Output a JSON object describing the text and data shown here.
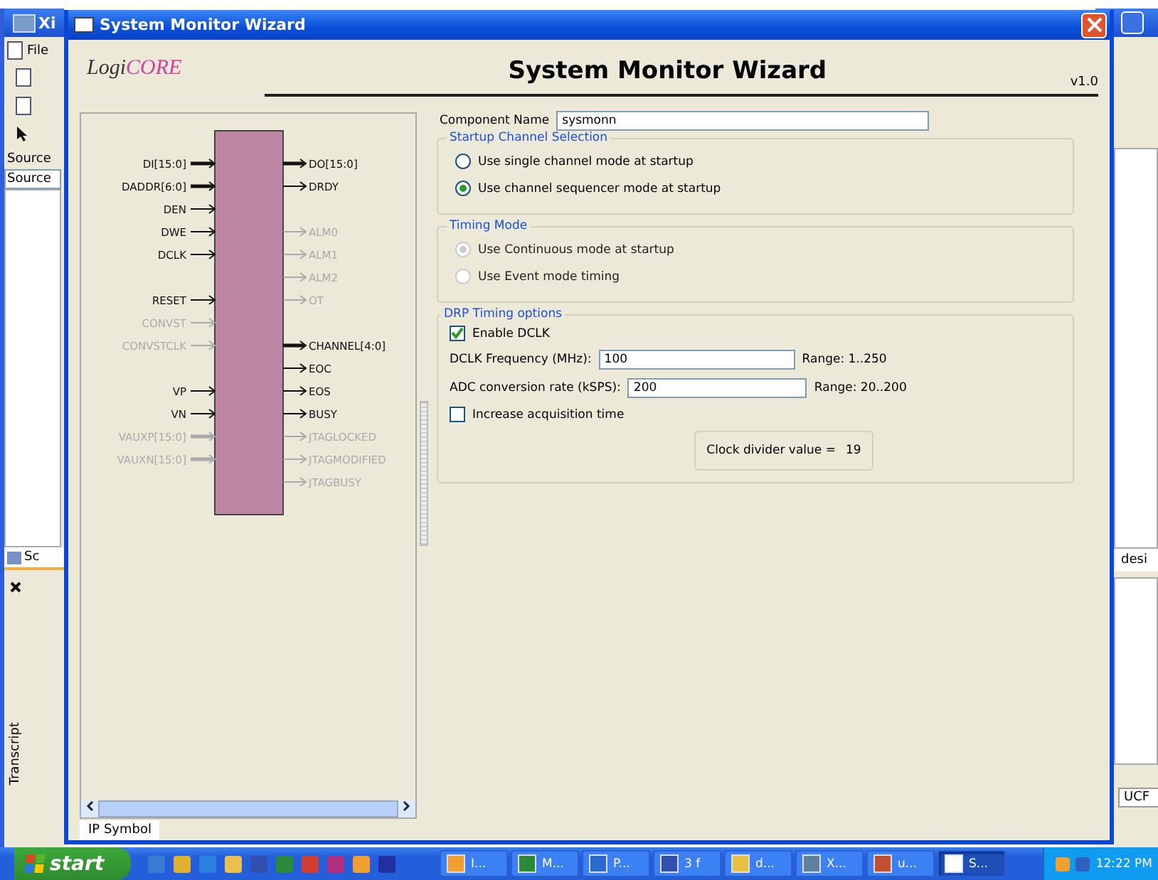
{
  "background_app": {
    "title": "Xi",
    "menu": "File",
    "source_label": "Source",
    "source_select": "Source",
    "source_tab": "Sc",
    "transcript": "Transcript",
    "right_tab": "desi",
    "ucf_tab": "UCF"
  },
  "window": {
    "title": "System Monitor Wizard"
  },
  "header": {
    "logo_a": "Logi",
    "logo_b": "CORE",
    "title": "System Monitor Wizard",
    "version": "v1.0"
  },
  "symbol": {
    "tab": "IP Symbol",
    "left_pin_groups": [
      {
        "pins": [
          {
            "label": "DI[15:0]",
            "bus": true,
            "enabled": true
          },
          {
            "label": "DADDR[6:0]",
            "bus": true,
            "enabled": true
          },
          {
            "label": "DEN",
            "bus": false,
            "enabled": true
          },
          {
            "label": "DWE",
            "bus": false,
            "enabled": true
          },
          {
            "label": "DCLK",
            "bus": false,
            "enabled": true
          }
        ]
      },
      {
        "pins": [
          {
            "label": "RESET",
            "bus": false,
            "enabled": true
          },
          {
            "label": "CONVST",
            "bus": false,
            "enabled": false
          },
          {
            "label": "CONVSTCLK",
            "bus": false,
            "enabled": false
          }
        ]
      },
      {
        "pins": [
          {
            "label": "VP",
            "bus": false,
            "enabled": true
          },
          {
            "label": "VN",
            "bus": false,
            "enabled": true
          },
          {
            "label": "VAUXP[15:0]",
            "bus": true,
            "enabled": false
          },
          {
            "label": "VAUXN[15:0]",
            "bus": true,
            "enabled": false
          }
        ]
      }
    ],
    "right_pin_groups": [
      {
        "pins": [
          {
            "label": "DO[15:0]",
            "bus": true,
            "enabled": true
          },
          {
            "label": "DRDY",
            "bus": false,
            "enabled": true
          }
        ]
      },
      {
        "pins": [
          {
            "label": "ALM0",
            "bus": false,
            "enabled": false
          },
          {
            "label": "ALM1",
            "bus": false,
            "enabled": false
          },
          {
            "label": "ALM2",
            "bus": false,
            "enabled": false
          },
          {
            "label": "OT",
            "bus": false,
            "enabled": false
          }
        ]
      },
      {
        "pins": [
          {
            "label": "CHANNEL[4:0]",
            "bus": true,
            "enabled": true
          },
          {
            "label": "EOC",
            "bus": false,
            "enabled": true
          },
          {
            "label": "EOS",
            "bus": false,
            "enabled": true
          },
          {
            "label": "BUSY",
            "bus": false,
            "enabled": true
          },
          {
            "label": "JTAGLOCKED",
            "bus": false,
            "enabled": false
          },
          {
            "label": "JTAGMODIFIED",
            "bus": false,
            "enabled": false
          },
          {
            "label": "JTAGBUSY",
            "bus": false,
            "enabled": false
          }
        ]
      }
    ]
  },
  "component_name": {
    "label": "Component Name",
    "value": "sysmonn"
  },
  "startup_channel": {
    "title": "Startup Channel Selection",
    "options": [
      {
        "label": "Use single channel mode at startup",
        "selected": false,
        "disabled": false
      },
      {
        "label": "Use channel sequencer mode at startup",
        "selected": true,
        "disabled": false
      }
    ]
  },
  "timing_mode": {
    "title": "Timing Mode",
    "options": [
      {
        "label": "Use Continuous mode at startup",
        "selected": true,
        "disabled": true
      },
      {
        "label": "Use Event mode timing",
        "selected": false,
        "disabled": true
      }
    ]
  },
  "drp_timing": {
    "title": "DRP Timing options",
    "enable_dclk": {
      "label": "Enable DCLK",
      "checked": true
    },
    "fields": [
      {
        "label": "DCLK Frequency (MHz):",
        "value": "100",
        "range": "Range: 1..250"
      },
      {
        "label": "ADC conversion rate (kSPS):",
        "value": "200",
        "range": "Range: 20..200"
      }
    ],
    "increase_acquisition": {
      "label": "Increase acquisition time",
      "checked": false
    },
    "clock_divider": {
      "label": "Clock divider value =",
      "value": "19"
    }
  },
  "taskbar": {
    "start": "start",
    "tasks": [
      {
        "label": "I...",
        "selected": false
      },
      {
        "label": "M...",
        "selected": false
      },
      {
        "label": "P...",
        "selected": false
      },
      {
        "label": "3 f",
        "selected": false
      },
      {
        "label": "d...",
        "selected": false
      },
      {
        "label": "X...",
        "selected": false
      },
      {
        "label": "u...",
        "selected": false
      },
      {
        "label": "S...",
        "selected": true
      }
    ],
    "clock": "12:22 PM"
  }
}
